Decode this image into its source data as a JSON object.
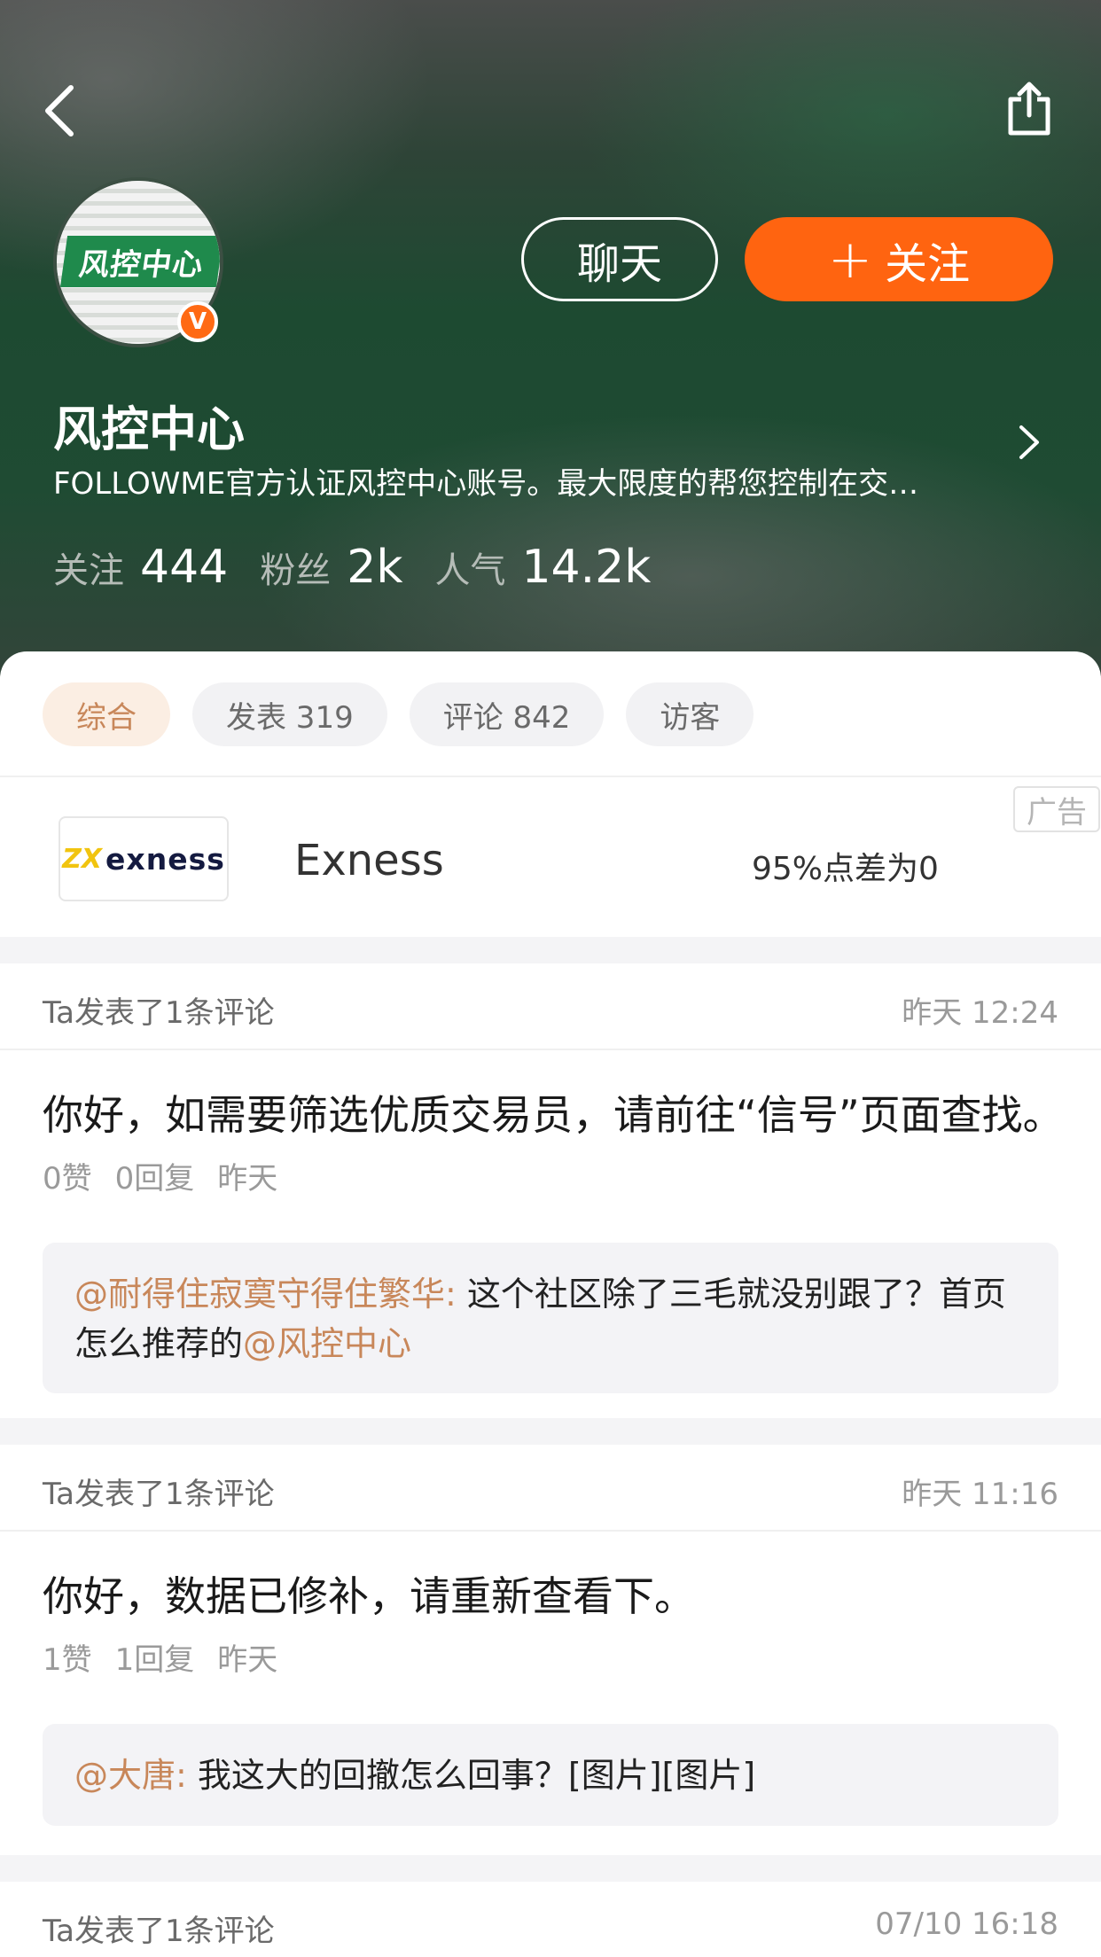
{
  "header": {
    "back_icon": "chevron-left-icon",
    "share_icon": "share-icon",
    "avatar_text": "风控中心",
    "verified_badge": "V",
    "chat_label": "聊天",
    "follow_plus": "+",
    "follow_label": "关注",
    "name": "风控中心",
    "description": "FOLLOWME官方认证风控中心账号。最大限度的帮您控制在交…",
    "stats": {
      "following_label": "关注",
      "following_value": "444",
      "fans_label": "粉丝",
      "fans_value": "2k",
      "popularity_label": "人气",
      "popularity_value": "14.2k"
    }
  },
  "tabs": [
    {
      "label": "综合",
      "active": true
    },
    {
      "label": "发表 319",
      "active": false
    },
    {
      "label": "评论 842",
      "active": false
    },
    {
      "label": "访客",
      "active": false
    }
  ],
  "ad": {
    "logo_mark": "ZX",
    "logo_word": "exness",
    "name": "Exness",
    "promo": "95%点差为0",
    "tag": "广告"
  },
  "feed": [
    {
      "who": "Ta发表了1条评论",
      "when": "昨天 12:24",
      "body": "你好，如需要筛选优质交易员，请前往“信号”页面查找。",
      "likes": "0赞",
      "replies": "0回复",
      "date": "昨天",
      "quote_mention": "@耐得住寂寞守得住繁华:",
      "quote_text": " 这个社区除了三毛就没别跟了？首页怎么推荐的",
      "quote_mention2": "@风控中心"
    },
    {
      "who": "Ta发表了1条评论",
      "when": "昨天 11:16",
      "body": "你好，数据已修补，请重新查看下。",
      "likes": "1赞",
      "replies": "1回复",
      "date": "昨天",
      "quote_mention": "@大唐:",
      "quote_text": " 我这大的回撤怎么回事？[图片][图片]"
    },
    {
      "who": "Ta发表了1条评论",
      "when": "07/10 16:18"
    }
  ],
  "colors": {
    "accent_orange": "#ff6410",
    "mention_color": "#c8875a",
    "header_green": "#1d4a31"
  }
}
